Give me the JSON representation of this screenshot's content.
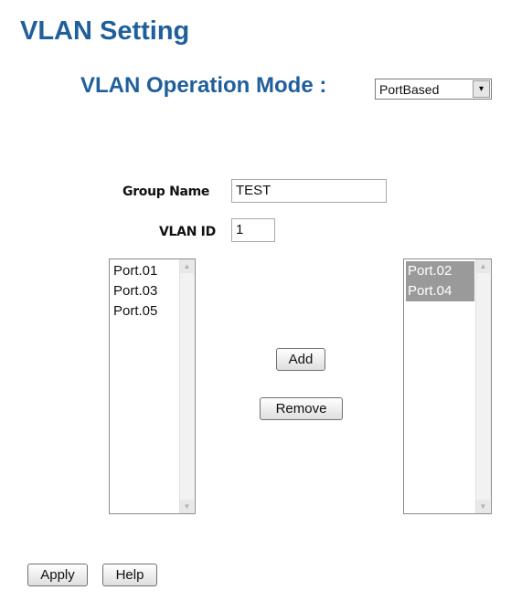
{
  "page": {
    "title": "VLAN Setting"
  },
  "mode": {
    "label": "VLAN Operation Mode :",
    "selected": "PortBased",
    "arrow": "▾"
  },
  "group": {
    "name_label": "Group Name",
    "name_value": "TEST",
    "id_label": "VLAN ID",
    "id_value": "1"
  },
  "available_ports": [
    "Port.01",
    "Port.03",
    "Port.05"
  ],
  "member_ports": [
    "Port.02",
    "Port.04"
  ],
  "buttons": {
    "add": "Add",
    "remove": "Remove",
    "apply": "Apply",
    "help": "Help"
  },
  "scrollbar": {
    "up": "▲",
    "down": "▼"
  }
}
